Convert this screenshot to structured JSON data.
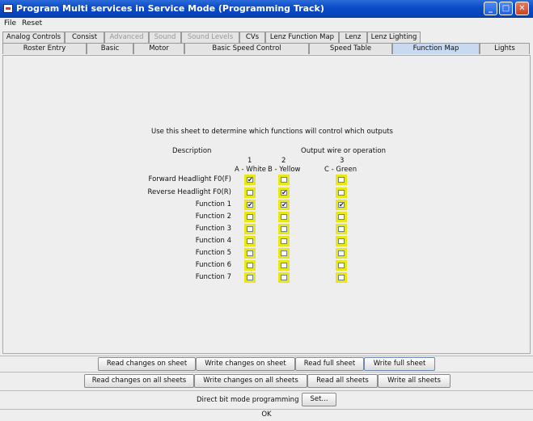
{
  "window": {
    "title": "Program Multi services in Service Mode (Programming Track)",
    "minimize_icon": "minimize-icon",
    "maximize_icon": "maximize-icon",
    "close_icon": "close-icon"
  },
  "menu": [
    "File",
    "Reset"
  ],
  "tabs_row1": [
    {
      "label": "Analog Controls",
      "enabled": true
    },
    {
      "label": "Consist",
      "enabled": true
    },
    {
      "label": "Advanced",
      "enabled": false
    },
    {
      "label": "Sound",
      "enabled": false
    },
    {
      "label": "Sound Levels",
      "enabled": false
    },
    {
      "label": "CVs",
      "enabled": true
    },
    {
      "label": "Lenz Function Map",
      "enabled": true
    },
    {
      "label": "Lenz",
      "enabled": true
    },
    {
      "label": "Lenz Lighting",
      "enabled": true
    }
  ],
  "tabs_row2": [
    {
      "label": "Roster Entry",
      "selected": false
    },
    {
      "label": "Basic",
      "selected": false
    },
    {
      "label": "Motor",
      "selected": false
    },
    {
      "label": "Basic Speed Control",
      "selected": false
    },
    {
      "label": "Speed Table",
      "selected": false
    },
    {
      "label": "Function Map",
      "selected": true
    },
    {
      "label": "Lights",
      "selected": false
    }
  ],
  "sheet": {
    "instruction": "Use this sheet to determine which functions will control which outputs",
    "description_header": "Description",
    "output_header": "Output wire or operation",
    "outputs": [
      {
        "number": "1",
        "name": "A - White"
      },
      {
        "number": "2",
        "name": "B - Yellow"
      },
      {
        "number": "3",
        "name": "C - Green"
      }
    ],
    "rows": [
      {
        "label": "Forward Headlight F0(F)",
        "checks": [
          true,
          false,
          false
        ]
      },
      {
        "label": "Reverse Headlight F0(R)",
        "checks": [
          false,
          true,
          false
        ]
      },
      {
        "label": "Function 1",
        "checks": [
          true,
          true,
          true
        ]
      },
      {
        "label": "Function 2",
        "checks": [
          false,
          false,
          false
        ]
      },
      {
        "label": "Function 3",
        "checks": [
          false,
          false,
          false
        ]
      },
      {
        "label": "Function 4",
        "checks": [
          false,
          false,
          false
        ]
      },
      {
        "label": "Function 5",
        "checks": [
          false,
          false,
          false
        ]
      },
      {
        "label": "Function 6",
        "checks": [
          false,
          false,
          false
        ]
      },
      {
        "label": "Function 7",
        "checks": [
          false,
          false,
          false
        ]
      }
    ],
    "check_mark": "✔"
  },
  "sheet_buttons": {
    "read_changes": "Read changes on sheet",
    "write_changes": "Write changes on sheet",
    "read_full": "Read full sheet",
    "write_full": "Write full sheet"
  },
  "all_buttons": {
    "read_changes": "Read changes on all sheets",
    "write_changes": "Write changes on all sheets",
    "read_all": "Read all sheets",
    "write_all": "Write all sheets"
  },
  "direct_bit": {
    "label": "Direct bit mode programming",
    "button": "Set..."
  },
  "status": "OK"
}
